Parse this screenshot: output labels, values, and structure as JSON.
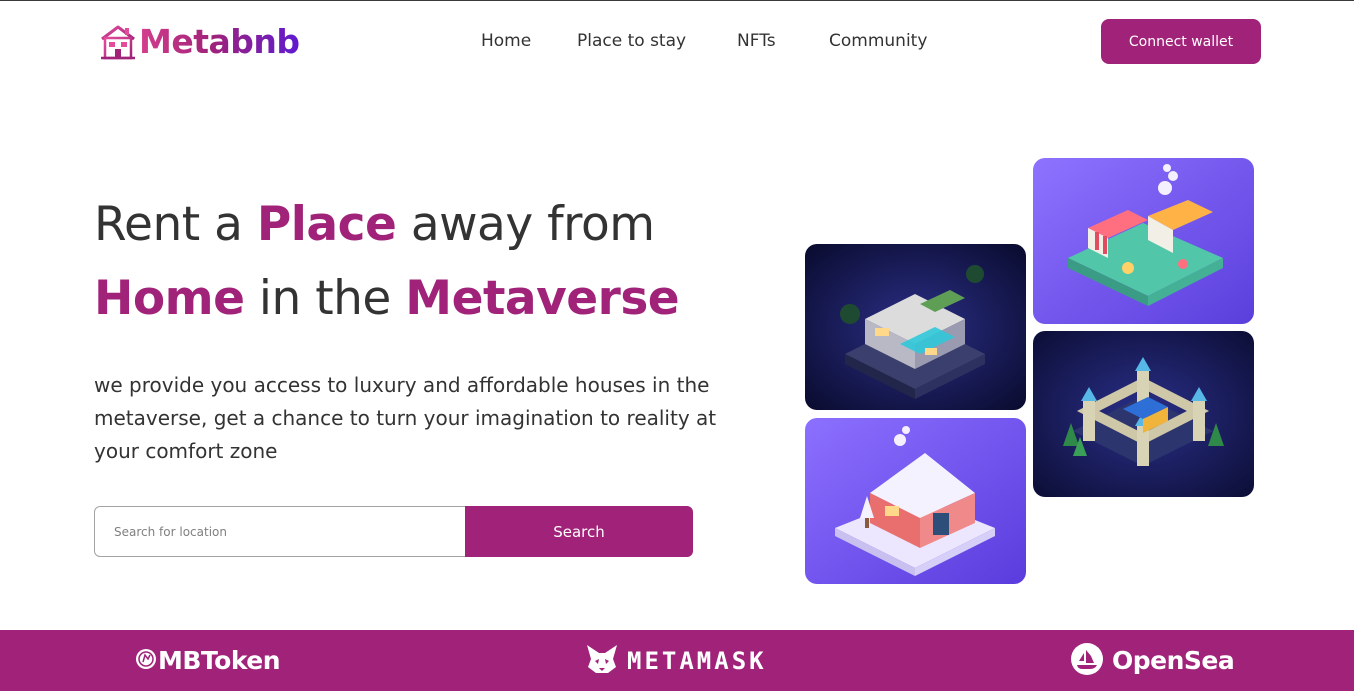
{
  "brand": {
    "name": "Metabnb",
    "logo_icon": "house-icon"
  },
  "nav": {
    "items": [
      {
        "label": "Home"
      },
      {
        "label": "Place to stay"
      },
      {
        "label": "NFTs"
      },
      {
        "label": "Community"
      }
    ],
    "connect_label": "Connect wallet"
  },
  "hero": {
    "title_part1": "Rent a ",
    "title_accent1": "Place",
    "title_part2": " away from",
    "title_accent2": "Home",
    "title_part3": " in the ",
    "title_accent3": "Metaverse",
    "description": "we provide you access to luxury and affordable houses in the metaverse, get a chance to turn your imagination to reality at your comfort zone",
    "search_placeholder": "Search for location",
    "search_label": "Search"
  },
  "gallery": {
    "images": [
      {
        "name": "modern-villa-image"
      },
      {
        "name": "market-stalls-image"
      },
      {
        "name": "snow-cottage-image"
      },
      {
        "name": "castle-image"
      }
    ]
  },
  "partners": [
    {
      "label": "MBToken",
      "icon": "mbtoken-coin-icon"
    },
    {
      "label": "METAMASK",
      "icon": "metamask-fox-icon"
    },
    {
      "label": "OpenSea",
      "icon": "opensea-boat-icon"
    }
  ],
  "colors": {
    "accent": "#A02279",
    "text": "#333333",
    "background": "#FFFFFF"
  }
}
